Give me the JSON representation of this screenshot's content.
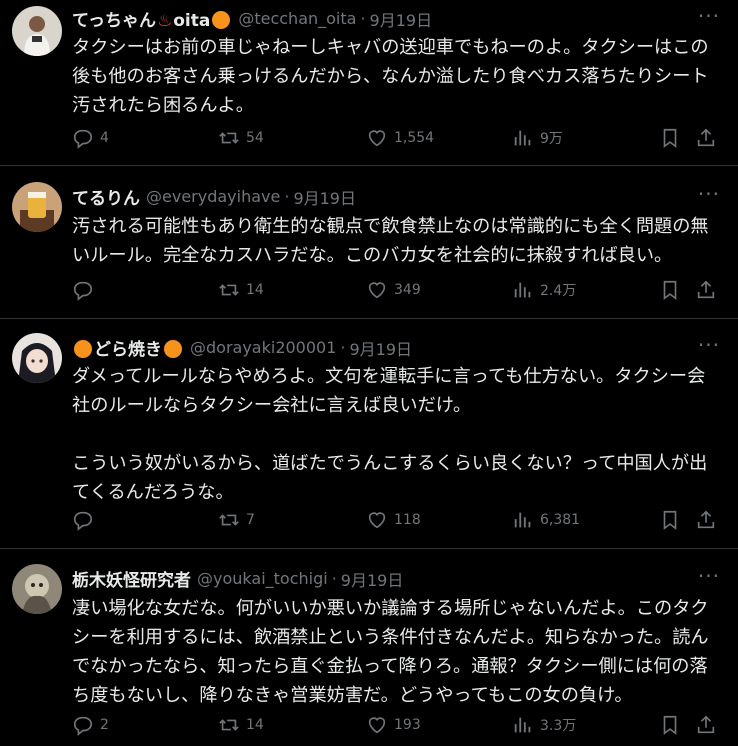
{
  "tweets": [
    {
      "name": "てっちゃん",
      "name_hot": "♨",
      "name_suffix": "oita",
      "handle": "@tecchan_oita",
      "sep": "·",
      "date": "9月19日",
      "text": "タクシーはお前の車じゃねーしキャバの送迎車でもねーのよ。タクシーはこの後も他のお客さん乗っけるんだから、なんか溢したり食べカス落ちたりシート汚されたら困るんよ。",
      "replies": "4",
      "retweets": "54",
      "likes": "1,554",
      "views": "9万"
    },
    {
      "name": "てるりん",
      "handle": "@everydayihave",
      "sep": "·",
      "date": "9月19日",
      "text": "汚される可能性もあり衛生的な観点で飲食禁止なのは常識的にも全く問題の無いルール。完全なカスハラだな。このバカ女を社会的に抹殺すれば良い。",
      "replies": "",
      "retweets": "14",
      "likes": "349",
      "views": "2.4万"
    },
    {
      "name": "どら焼き",
      "handle": "@dorayaki200001",
      "sep": "·",
      "date": "9月19日",
      "text": "ダメってルールならやめろよ。文句を運転手に言っても仕方ない。タクシー会社のルールならタクシー会社に言えば良いだけ。\n\nこういう奴がいるから、道ばたでうんこするくらい良くない？って中国人が出てくるんだろうな。",
      "replies": "",
      "retweets": "7",
      "likes": "118",
      "views": "6,381"
    },
    {
      "name": "栃木妖怪研究者",
      "handle": "@youkai_tochigi",
      "sep": "·",
      "date": "9月19日",
      "text": "凄い場化な女だな。何がいいか悪いか議論する場所じゃないんだよ。このタクシーを利用するには、飲酒禁止という条件付きなんだよ。知らなかった。読んでなかったなら、知ったら直ぐ金払って降りろ。通報？タクシー側には何の落ち度もないし、降りなきゃ営業妨害だ。どうやってもこの女の負け。",
      "replies": "2",
      "retweets": "14",
      "likes": "193",
      "views": "3.3万"
    }
  ],
  "colors": {
    "background": "#000000",
    "text": "#e7e9ea",
    "muted": "#71767b",
    "border": "#2f3336",
    "orange_emoji": "#f7931a"
  },
  "icons": {
    "more": "more-dots-icon",
    "reply": "reply-icon",
    "retweet": "retweet-icon",
    "like": "heart-icon",
    "views": "views-icon",
    "bookmark": "bookmark-icon",
    "share": "share-icon"
  }
}
